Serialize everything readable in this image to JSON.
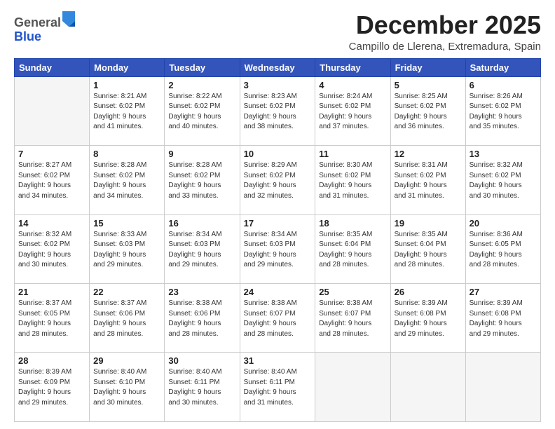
{
  "logo": {
    "general": "General",
    "blue": "Blue"
  },
  "header": {
    "month": "December 2025",
    "location": "Campillo de Llerena, Extremadura, Spain"
  },
  "weekdays": [
    "Sunday",
    "Monday",
    "Tuesday",
    "Wednesday",
    "Thursday",
    "Friday",
    "Saturday"
  ],
  "weeks": [
    [
      {
        "day": "",
        "info": ""
      },
      {
        "day": "1",
        "info": "Sunrise: 8:21 AM\nSunset: 6:02 PM\nDaylight: 9 hours\nand 41 minutes."
      },
      {
        "day": "2",
        "info": "Sunrise: 8:22 AM\nSunset: 6:02 PM\nDaylight: 9 hours\nand 40 minutes."
      },
      {
        "day": "3",
        "info": "Sunrise: 8:23 AM\nSunset: 6:02 PM\nDaylight: 9 hours\nand 38 minutes."
      },
      {
        "day": "4",
        "info": "Sunrise: 8:24 AM\nSunset: 6:02 PM\nDaylight: 9 hours\nand 37 minutes."
      },
      {
        "day": "5",
        "info": "Sunrise: 8:25 AM\nSunset: 6:02 PM\nDaylight: 9 hours\nand 36 minutes."
      },
      {
        "day": "6",
        "info": "Sunrise: 8:26 AM\nSunset: 6:02 PM\nDaylight: 9 hours\nand 35 minutes."
      }
    ],
    [
      {
        "day": "7",
        "info": "Sunrise: 8:27 AM\nSunset: 6:02 PM\nDaylight: 9 hours\nand 34 minutes."
      },
      {
        "day": "8",
        "info": "Sunrise: 8:28 AM\nSunset: 6:02 PM\nDaylight: 9 hours\nand 34 minutes."
      },
      {
        "day": "9",
        "info": "Sunrise: 8:28 AM\nSunset: 6:02 PM\nDaylight: 9 hours\nand 33 minutes."
      },
      {
        "day": "10",
        "info": "Sunrise: 8:29 AM\nSunset: 6:02 PM\nDaylight: 9 hours\nand 32 minutes."
      },
      {
        "day": "11",
        "info": "Sunrise: 8:30 AM\nSunset: 6:02 PM\nDaylight: 9 hours\nand 31 minutes."
      },
      {
        "day": "12",
        "info": "Sunrise: 8:31 AM\nSunset: 6:02 PM\nDaylight: 9 hours\nand 31 minutes."
      },
      {
        "day": "13",
        "info": "Sunrise: 8:32 AM\nSunset: 6:02 PM\nDaylight: 9 hours\nand 30 minutes."
      }
    ],
    [
      {
        "day": "14",
        "info": "Sunrise: 8:32 AM\nSunset: 6:02 PM\nDaylight: 9 hours\nand 30 minutes."
      },
      {
        "day": "15",
        "info": "Sunrise: 8:33 AM\nSunset: 6:03 PM\nDaylight: 9 hours\nand 29 minutes."
      },
      {
        "day": "16",
        "info": "Sunrise: 8:34 AM\nSunset: 6:03 PM\nDaylight: 9 hours\nand 29 minutes."
      },
      {
        "day": "17",
        "info": "Sunrise: 8:34 AM\nSunset: 6:03 PM\nDaylight: 9 hours\nand 29 minutes."
      },
      {
        "day": "18",
        "info": "Sunrise: 8:35 AM\nSunset: 6:04 PM\nDaylight: 9 hours\nand 28 minutes."
      },
      {
        "day": "19",
        "info": "Sunrise: 8:35 AM\nSunset: 6:04 PM\nDaylight: 9 hours\nand 28 minutes."
      },
      {
        "day": "20",
        "info": "Sunrise: 8:36 AM\nSunset: 6:05 PM\nDaylight: 9 hours\nand 28 minutes."
      }
    ],
    [
      {
        "day": "21",
        "info": "Sunrise: 8:37 AM\nSunset: 6:05 PM\nDaylight: 9 hours\nand 28 minutes."
      },
      {
        "day": "22",
        "info": "Sunrise: 8:37 AM\nSunset: 6:06 PM\nDaylight: 9 hours\nand 28 minutes."
      },
      {
        "day": "23",
        "info": "Sunrise: 8:38 AM\nSunset: 6:06 PM\nDaylight: 9 hours\nand 28 minutes."
      },
      {
        "day": "24",
        "info": "Sunrise: 8:38 AM\nSunset: 6:07 PM\nDaylight: 9 hours\nand 28 minutes."
      },
      {
        "day": "25",
        "info": "Sunrise: 8:38 AM\nSunset: 6:07 PM\nDaylight: 9 hours\nand 28 minutes."
      },
      {
        "day": "26",
        "info": "Sunrise: 8:39 AM\nSunset: 6:08 PM\nDaylight: 9 hours\nand 29 minutes."
      },
      {
        "day": "27",
        "info": "Sunrise: 8:39 AM\nSunset: 6:08 PM\nDaylight: 9 hours\nand 29 minutes."
      }
    ],
    [
      {
        "day": "28",
        "info": "Sunrise: 8:39 AM\nSunset: 6:09 PM\nDaylight: 9 hours\nand 29 minutes."
      },
      {
        "day": "29",
        "info": "Sunrise: 8:40 AM\nSunset: 6:10 PM\nDaylight: 9 hours\nand 30 minutes."
      },
      {
        "day": "30",
        "info": "Sunrise: 8:40 AM\nSunset: 6:11 PM\nDaylight: 9 hours\nand 30 minutes."
      },
      {
        "day": "31",
        "info": "Sunrise: 8:40 AM\nSunset: 6:11 PM\nDaylight: 9 hours\nand 31 minutes."
      },
      {
        "day": "",
        "info": ""
      },
      {
        "day": "",
        "info": ""
      },
      {
        "day": "",
        "info": ""
      }
    ]
  ]
}
